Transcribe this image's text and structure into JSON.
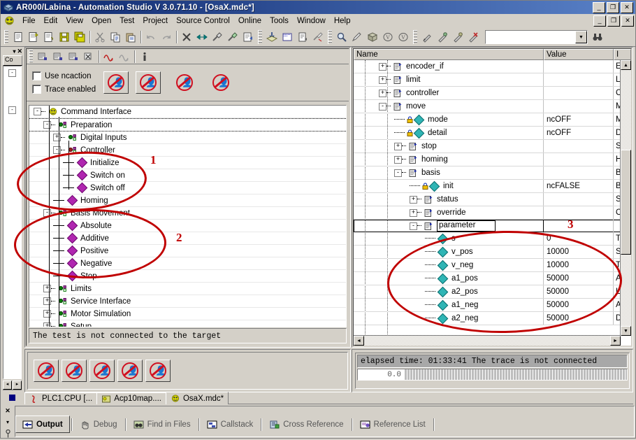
{
  "window": {
    "title": "AR000/Labina - Automation Studio V 3.0.71.10 - [OsaX.mdc*]",
    "app_icon": "cube-icon",
    "buttons": {
      "minimize": "_",
      "restore": "❐",
      "close": "✕"
    }
  },
  "menubar": {
    "app_icon": "automation-studio-icon",
    "items": [
      "File",
      "Edit",
      "View",
      "Open",
      "Test",
      "Project",
      "Source Control",
      "Online",
      "Tools",
      "Window",
      "Help"
    ],
    "mdi_buttons": {
      "minimize": "_",
      "restore": "❐",
      "close": "✕"
    }
  },
  "toolbar": {
    "groups": [
      {
        "icons": [
          "new-file-icon",
          "new-document-icon",
          "open-document-icon",
          "save-icon",
          "save-all-icon"
        ]
      },
      {
        "icons": [
          "cut-icon",
          "copy-icon",
          "paste-icon"
        ]
      },
      {
        "icons": [
          "undo-icon",
          "redo-icon"
        ]
      },
      {
        "icons": [
          "delete-icon",
          "resize-icon",
          "build-icon",
          "rebuild-icon",
          "properties-icon"
        ]
      },
      {
        "icons": [
          "transfer-icon",
          "simulation-icon",
          "report-icon",
          "diagnose-icon"
        ]
      },
      {
        "icons": [
          "zoom-icon",
          "edit-object-icon",
          "package-icon",
          "version-icon",
          "version-alt-icon"
        ]
      },
      {
        "icons": [
          "run-icon",
          "debug-icon",
          "step-icon",
          "stop-debug-icon"
        ]
      }
    ],
    "search": {
      "value": "",
      "placeholder": "",
      "dropdown_arrow": "▼",
      "find_icon": "binoculars-icon"
    }
  },
  "left_strip": {
    "tab_label": "Co",
    "close_icon": "✕",
    "collapse_icon": "▾",
    "nodes": [
      "-",
      "-"
    ],
    "nav": {
      "prev": "◂",
      "next": "▸"
    }
  },
  "left_pane": {
    "toolbar_icons": [
      "insert-before-icon",
      "insert-after-icon",
      "insert-child-icon",
      "delete-node-icon",
      "curve-icon",
      "curve-gray-icon",
      "info-icon"
    ],
    "options": {
      "checkboxes": [
        {
          "label": "Use ncaction",
          "underline": "U",
          "checked": false
        },
        {
          "label": "Trace enabled",
          "underline": "c",
          "checked": false
        }
      ],
      "buttons": [
        "no-action-icon",
        "no-action-icon",
        "no-action-icon",
        "no-action-icon"
      ]
    },
    "tree": [
      {
        "label": "Command Interface",
        "indent": 0,
        "toggle": "-",
        "icon": "project-icon",
        "selected": false
      },
      {
        "label": "Preparation",
        "indent": 1,
        "toggle": "-",
        "icon": "group-icon",
        "selected": true
      },
      {
        "label": "Digital Inputs",
        "indent": 2,
        "toggle": "+",
        "icon": "group-icon",
        "selected": false
      },
      {
        "label": "Controller",
        "indent": 2,
        "toggle": "-",
        "icon": "group-red-icon",
        "selected": false
      },
      {
        "label": "Initialize",
        "indent": 3,
        "toggle": "",
        "icon": "action-icon",
        "selected": false
      },
      {
        "label": "Switch on",
        "indent": 3,
        "toggle": "",
        "icon": "action-icon",
        "selected": false
      },
      {
        "label": "Switch off",
        "indent": 3,
        "toggle": "",
        "icon": "action-icon",
        "selected": false
      },
      {
        "label": "Homing",
        "indent": 2,
        "toggle": "",
        "icon": "action-icon",
        "selected": false
      },
      {
        "label": "Basis Movement",
        "indent": 1,
        "toggle": "-",
        "icon": "group-icon",
        "selected": false
      },
      {
        "label": "Absolute",
        "indent": 2,
        "toggle": "",
        "icon": "action-icon",
        "selected": false
      },
      {
        "label": "Additive",
        "indent": 2,
        "toggle": "",
        "icon": "action-icon",
        "selected": false
      },
      {
        "label": "Positive",
        "indent": 2,
        "toggle": "",
        "icon": "action-icon",
        "selected": false
      },
      {
        "label": "Negative",
        "indent": 2,
        "toggle": "",
        "icon": "action-icon",
        "selected": false
      },
      {
        "label": "Stop",
        "indent": 2,
        "toggle": "",
        "icon": "action-icon",
        "selected": false
      },
      {
        "label": "Limits",
        "indent": 1,
        "toggle": "+",
        "icon": "group-icon",
        "selected": false
      },
      {
        "label": "Service Interface",
        "indent": 1,
        "toggle": "+",
        "icon": "group-icon",
        "selected": false
      },
      {
        "label": "Motor Simulation",
        "indent": 1,
        "toggle": "+",
        "icon": "group-icon",
        "selected": false
      },
      {
        "label": "Setup",
        "indent": 1,
        "toggle": "+",
        "icon": "group-icon",
        "selected": false
      }
    ],
    "status": "The test is not connected to the target"
  },
  "left_bottom": {
    "buttons": [
      "no-action-icon",
      "no-action-icon",
      "no-action-icon",
      "no-action-icon",
      "no-action-icon"
    ]
  },
  "right_pane": {
    "columns": [
      "Name",
      "Value",
      "I"
    ],
    "rows": [
      {
        "name": "encoder_if",
        "indent": 1,
        "toggle": "+",
        "icon": "struct-icon",
        "value": "",
        "col3": "E",
        "selected": false
      },
      {
        "name": "limit",
        "indent": 1,
        "toggle": "+",
        "icon": "struct-icon",
        "value": "",
        "col3": "L",
        "selected": false
      },
      {
        "name": "controller",
        "indent": 1,
        "toggle": "+",
        "icon": "struct-icon",
        "value": "",
        "col3": "C",
        "selected": false
      },
      {
        "name": "move",
        "indent": 1,
        "toggle": "-",
        "icon": "struct-icon",
        "value": "",
        "col3": "M",
        "selected": false
      },
      {
        "name": "mode",
        "indent": 2,
        "toggle": "",
        "icon": "var-locked-icon",
        "value": "ncOFF",
        "col3": "M",
        "selected": false
      },
      {
        "name": "detail",
        "indent": 2,
        "toggle": "",
        "icon": "var-locked-icon",
        "value": "ncOFF",
        "col3": "D",
        "selected": false
      },
      {
        "name": "stop",
        "indent": 2,
        "toggle": "+",
        "icon": "struct-icon",
        "value": "",
        "col3": "S",
        "selected": false
      },
      {
        "name": "homing",
        "indent": 2,
        "toggle": "+",
        "icon": "struct-icon",
        "value": "",
        "col3": "H",
        "selected": false
      },
      {
        "name": "basis",
        "indent": 2,
        "toggle": "-",
        "icon": "struct-icon",
        "value": "",
        "col3": "B",
        "selected": false
      },
      {
        "name": "init",
        "indent": 3,
        "toggle": "",
        "icon": "var-locked-icon",
        "value": "ncFALSE",
        "col3": "B",
        "selected": false
      },
      {
        "name": "status",
        "indent": 3,
        "toggle": "+",
        "icon": "struct-icon",
        "value": "",
        "col3": "S",
        "selected": false
      },
      {
        "name": "override",
        "indent": 3,
        "toggle": "+",
        "icon": "struct-icon",
        "value": "",
        "col3": "O",
        "selected": false
      },
      {
        "name": "parameter",
        "indent": 3,
        "toggle": "-",
        "icon": "struct-icon",
        "value": "",
        "col3": "",
        "selected": true
      },
      {
        "name": "s",
        "indent": 4,
        "toggle": "",
        "icon": "var-icon",
        "value": "0",
        "col3": "T",
        "selected": false
      },
      {
        "name": "v_pos",
        "indent": 4,
        "toggle": "",
        "icon": "var-icon",
        "value": "10000",
        "col3": "S",
        "selected": false
      },
      {
        "name": "v_neg",
        "indent": 4,
        "toggle": "",
        "icon": "var-icon",
        "value": "10000",
        "col3": "T",
        "selected": false
      },
      {
        "name": "a1_pos",
        "indent": 4,
        "toggle": "",
        "icon": "var-icon",
        "value": "50000",
        "col3": "A",
        "selected": false
      },
      {
        "name": "a2_pos",
        "indent": 4,
        "toggle": "",
        "icon": "var-icon",
        "value": "50000",
        "col3": "L",
        "selected": false
      },
      {
        "name": "a1_neg",
        "indent": 4,
        "toggle": "",
        "icon": "var-icon",
        "value": "50000",
        "col3": "A",
        "selected": false
      },
      {
        "name": "a2_neg",
        "indent": 4,
        "toggle": "",
        "icon": "var-icon",
        "value": "50000",
        "col3": "D",
        "selected": false
      }
    ],
    "scroll": {
      "up": "▲",
      "down": "▼",
      "left": "◄",
      "right": "►"
    }
  },
  "trace_pane": {
    "message": "elapsed time: 01:33:41  The trace is not connected",
    "value": "0.0"
  },
  "file_tabs": [
    {
      "label": "PLC1.CPU [...",
      "icon": "cpu-icon",
      "active": false
    },
    {
      "label": "Acp10map....",
      "icon": "map-icon",
      "active": false
    },
    {
      "label": "OsaX.mdc*",
      "icon": "mdc-icon",
      "active": true
    }
  ],
  "bottom_tabs": {
    "close_icon": "✕",
    "collapse_icon": "▾",
    "pin_icon": "pin-icon",
    "items": [
      {
        "label": "Output",
        "icon": "output-icon",
        "active": true
      },
      {
        "label": "Debug",
        "icon": "debug-hand-icon",
        "active": false
      },
      {
        "label": "Find in Files",
        "icon": "find-binoculars-icon",
        "active": false
      },
      {
        "label": "Callstack",
        "icon": "callstack-icon",
        "active": false
      },
      {
        "label": "Cross Reference",
        "icon": "cross-reference-icon",
        "active": false
      },
      {
        "label": "Reference List",
        "icon": "reference-list-icon",
        "active": false
      }
    ]
  },
  "annotations": [
    {
      "number": "1"
    },
    {
      "number": "2"
    },
    {
      "number": "3"
    }
  ],
  "colors": {
    "title_start": "#0a246a",
    "title_end": "#5a82c8",
    "chrome": "#d4d0c8",
    "annotation_red": "#c00000",
    "action_purple": "#b026b0",
    "var_teal": "#2fb5b5"
  }
}
